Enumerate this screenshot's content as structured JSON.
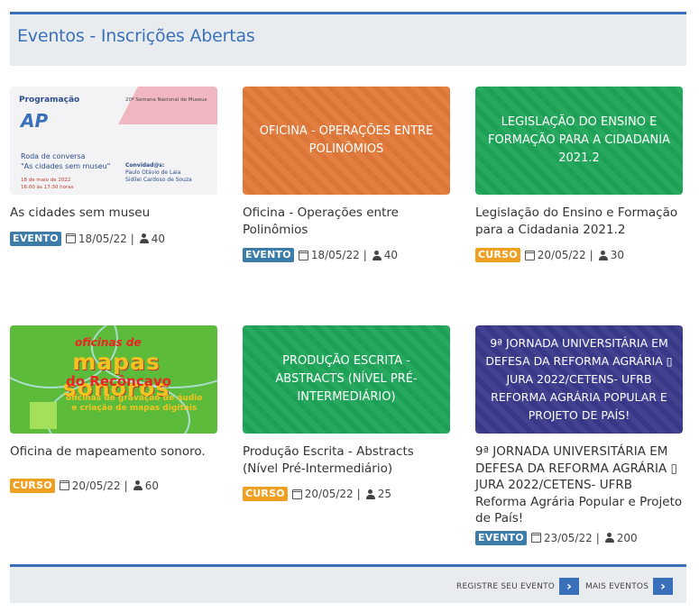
{
  "header": {
    "title": "Eventos - Inscrições Abertas"
  },
  "cards": [
    {
      "title": "As cidades sem museu",
      "type": "EVENTO",
      "date": "18/05/22",
      "count": "40",
      "thumb": {
        "kind": "poster",
        "heading": "Programação",
        "small": "20ª Semana Nacional de Museus",
        "logo": "AP",
        "roda_1": "Roda de conversa",
        "roda_2": "\"As cidades sem museu\"",
        "date_1": "18 de maio de 2022",
        "date_2": "16:00 às 17:30 horas",
        "convidados": "Convidad@s:",
        "guest_1": "Paulo Otávio de Laia",
        "guest_2": "Sidilei Cardoso de Souza"
      }
    },
    {
      "title": "Oficina - Operações entre Polinômios",
      "type": "EVENTO",
      "date": "18/05/22",
      "count": "40",
      "thumb": {
        "kind": "text",
        "text": "OFICINA - OPERAÇÕES ENTRE POLINÔMIOS",
        "color": "#e37a3a"
      }
    },
    {
      "title": "Legislação do Ensino e Formação para a Cidadania 2021.2",
      "type": "CURSO",
      "date": "20/05/22",
      "count": "30",
      "thumb": {
        "kind": "text",
        "text": "LEGISLAÇÃO DO ENSINO E FORMAÇÃO PARA A CIDADANIA 2021.2",
        "color": "#1fa65a"
      }
    },
    {
      "title": "Oficina de mapeamento sonoro.",
      "type": "CURSO",
      "date": "20/05/22",
      "count": "60",
      "thumb": {
        "kind": "map",
        "line_1": "oficinas de",
        "line_2": "mapas sonoros",
        "line_3": "do Recôncavo",
        "line_4": "oficinas de gravação de áudio",
        "line_5": "e criação de mapas digitais"
      }
    },
    {
      "title": "Produção Escrita - Abstracts (Nível Pré-Intermediário)",
      "type": "CURSO",
      "date": "20/05/22",
      "count": "25",
      "thumb": {
        "kind": "text",
        "text": "PRODUÇÃO ESCRITA - ABSTRACTS (NÍVEL PRÉ-INTERMEDIÁRIO)",
        "color": "#1fa65a"
      }
    },
    {
      "title": "9ª JORNADA UNIVERSITÁRIA EM DEFESA DA REFORMA AGRÁRIA ▯ JURA 2022/CETENS- UFRB Reforma Agrária Popular e Projeto de País!",
      "type": "EVENTO",
      "date": "23/05/22",
      "count": "200",
      "thumb": {
        "kind": "text",
        "text": "9ª JORNADA UNIVERSITÁRIA EM DEFESA DA REFORMA AGRÁRIA ▯ JURA 2022/CETENS- UFRB REFORMA AGRÁRIA POPULAR E PROJETO DE PAÍS!",
        "color": "#3a3a8c"
      }
    }
  ],
  "footer": {
    "register_label": "REGISTRE SEU EVENTO",
    "more_label": "MAIS EVENTOS",
    "arrow": "›"
  },
  "colors": {
    "accent": "#3a6fba",
    "evento": "#3c7ca8",
    "curso": "#f0a020"
  },
  "icons": {
    "date": "calendar-icon",
    "count": "user-icon"
  }
}
